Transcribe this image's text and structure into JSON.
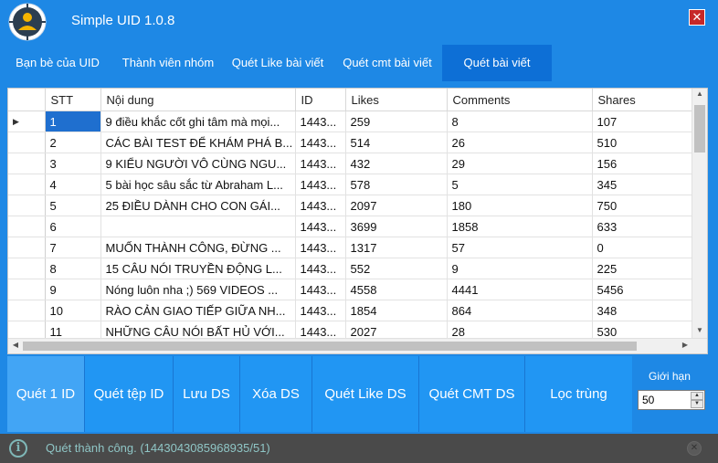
{
  "app": {
    "title": "Simple UID 1.0.8",
    "close_label": "✕"
  },
  "tabs": [
    {
      "label": "Bạn bè của UID"
    },
    {
      "label": "Thành viên nhóm"
    },
    {
      "label": "Quét Like bài viết"
    },
    {
      "label": "Quét cmt bài viết"
    },
    {
      "label": "Quét bài viết",
      "active": true
    }
  ],
  "grid": {
    "columns": [
      "STT",
      "Nội dung",
      "ID",
      "Likes",
      "Comments",
      "Shares"
    ],
    "current_row_marker": "▶",
    "rows": [
      [
        "1",
        "9 điều khắc cốt ghi tâm mà mọi...",
        "1443...",
        "259",
        "8",
        "107"
      ],
      [
        "2",
        "CÁC BÀI TEST ĐỂ KHÁM PHÁ B...",
        "1443...",
        "514",
        "26",
        "510"
      ],
      [
        "3",
        "9 KIỂU NGƯỜI VÔ CÙNG NGU...",
        "1443...",
        "432",
        "29",
        "156"
      ],
      [
        "4",
        "5 bài học sâu sắc từ Abraham L...",
        "1443...",
        "578",
        "5",
        "345"
      ],
      [
        "5",
        "25 ĐIỀU DÀNH CHO CON GÁI...",
        "1443...",
        "2097",
        "180",
        "750"
      ],
      [
        "6",
        "",
        "1443...",
        "3699",
        "1858",
        "633"
      ],
      [
        "7",
        "MUỐN THÀNH CÔNG, ĐỪNG ...",
        "1443...",
        "1317",
        "57",
        "0"
      ],
      [
        "8",
        "15 CÂU NÓI TRUYỀN ĐỘNG L...",
        "1443...",
        "552",
        "9",
        "225"
      ],
      [
        "9",
        "Nóng luôn nha ;) 569 VIDEOS ...",
        "1443...",
        "4558",
        "4441",
        "5456"
      ],
      [
        "10",
        "RÀO CẢN GIAO TIẾP GIỮA NH...",
        "1443...",
        "1854",
        "864",
        "348"
      ],
      [
        "11",
        "NHỮNG CÂU NÓI BẤT HỦ VỚI...",
        "1443...",
        "2027",
        "28",
        "530"
      ]
    ]
  },
  "actions": [
    {
      "label": "Quét 1 ID"
    },
    {
      "label": "Quét tệp ID"
    },
    {
      "label": "Lưu DS"
    },
    {
      "label": "Xóa DS"
    },
    {
      "label": "Quét Like DS"
    },
    {
      "label": "Quét CMT DS"
    },
    {
      "label": "Lọc trùng"
    }
  ],
  "limit": {
    "label": "Giới hạn",
    "value": "50"
  },
  "status": {
    "text": "Quét thành công. (1443043085968935/51)"
  }
}
